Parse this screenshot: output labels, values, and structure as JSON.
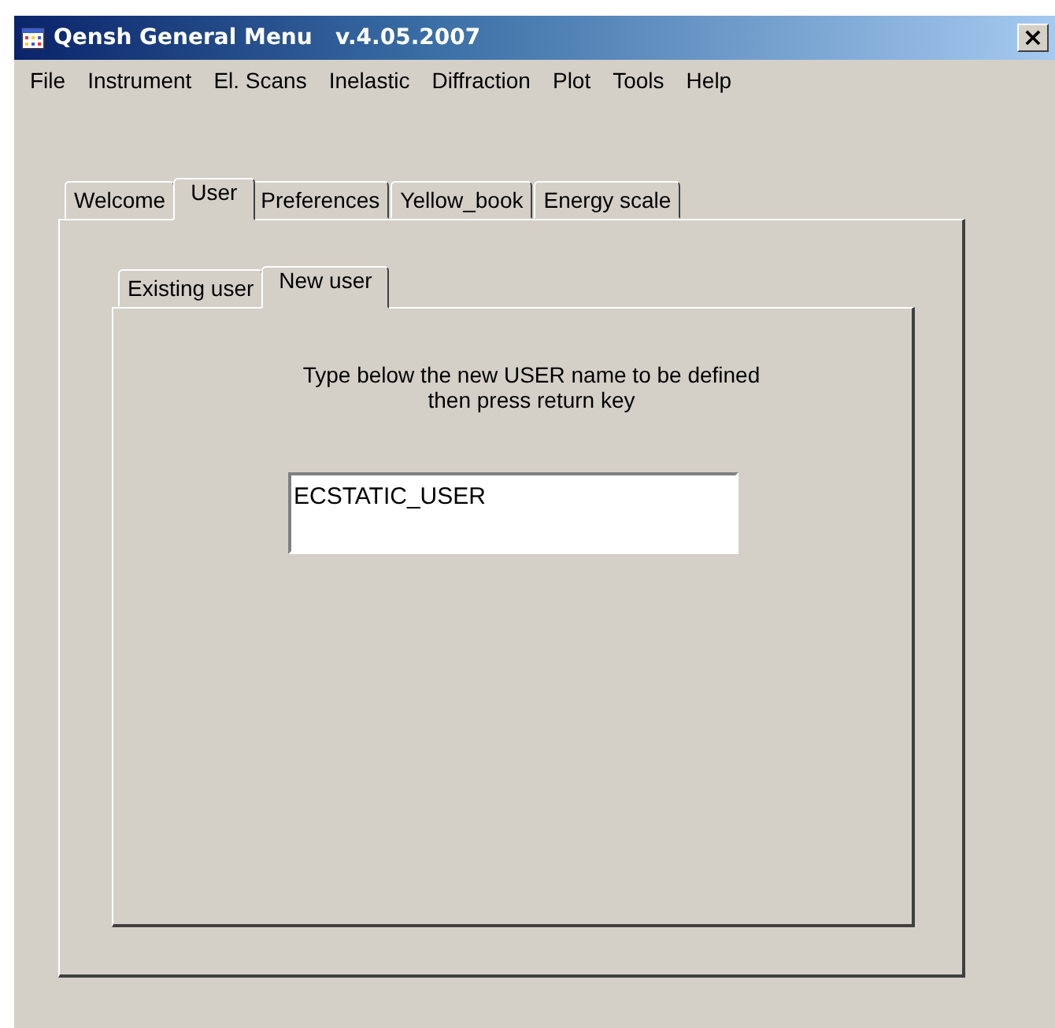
{
  "window": {
    "title": "Qensh General Menu   v.4.05.2007",
    "close": "×"
  },
  "menu": [
    "File",
    "Instrument",
    "El. Scans",
    "Inelastic",
    "Diffraction",
    "Plot",
    "Tools",
    "Help"
  ],
  "tabs": [
    {
      "label": "Welcome",
      "selected": false
    },
    {
      "label": "User",
      "selected": true
    },
    {
      "label": "Preferences",
      "selected": false
    },
    {
      "label": "Yellow_book",
      "selected": false
    },
    {
      "label": "Energy scale",
      "selected": false
    }
  ],
  "subtabs": [
    {
      "label": "Existing user",
      "selected": false
    },
    {
      "label": "New user",
      "selected": true
    }
  ],
  "instruction": "Type below the new USER name to be defined\nthen press return key",
  "name_field": {
    "value": "ECSTATIC_USER"
  }
}
